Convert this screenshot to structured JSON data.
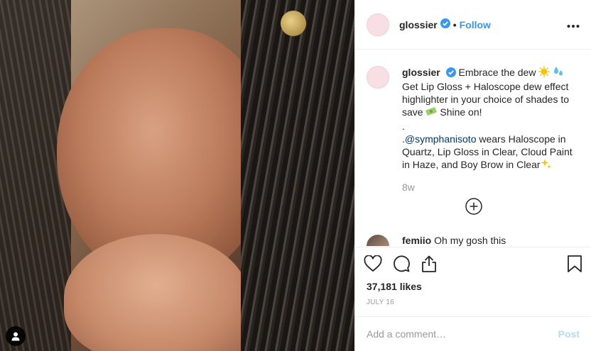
{
  "post": {
    "account": "glossier",
    "follow_label": "Follow",
    "separator": "•",
    "caption": {
      "line1": "Embrace the dew",
      "line2": "Get Lip Gloss + Haloscope dew effect highlighter in your choice of shades to save",
      "line2_end": "Shine on!",
      "dot_line": ".",
      "mention_prefix": ".",
      "mention": "@symphanisoto",
      "line3": "wears Haloscope in Quartz, Lip Gloss in Clear, Cloud Paint in Haze, and Boy Brow in Clear"
    },
    "age": "8w",
    "next_comment": {
      "user": "femiio",
      "text": "Oh my gosh this"
    },
    "likes": "37,181 likes",
    "date": "JULY 16",
    "comment_placeholder": "Add a comment…",
    "post_label": "Post"
  },
  "icons": {
    "verified": "verified-badge-icon",
    "more": "more-options-icon",
    "load_more": "load-more-plus-icon",
    "like": "heart-icon",
    "comment": "comment-bubble-icon",
    "share": "share-icon",
    "save": "bookmark-icon",
    "user_tag": "user-tag-icon"
  },
  "colors": {
    "accent": "#3897f0",
    "verified": "#3897f0",
    "post_disabled": "#b3dbff",
    "avatar": "#f7dfe4"
  }
}
